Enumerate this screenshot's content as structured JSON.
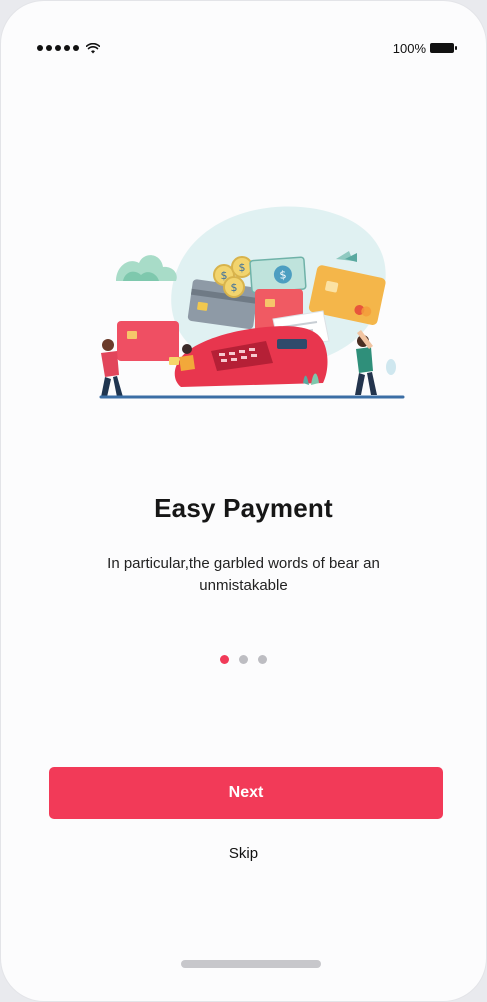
{
  "status_bar": {
    "battery_text": "100%",
    "signal_icon": "signal-dots-icon",
    "wifi_icon": "wifi-icon",
    "battery_icon": "battery-icon"
  },
  "illustration": {
    "icon": "payment-illustration"
  },
  "onboarding": {
    "title": "Easy Payment",
    "description": "In particular,the garbled words of bear an unmistakable",
    "page_count": 3,
    "active_page": 1
  },
  "actions": {
    "next_label": "Next",
    "skip_label": "Skip"
  },
  "colors": {
    "accent": "#f23a58",
    "inactive_dot": "#bdbdc2",
    "background": "#fcfcfd"
  }
}
